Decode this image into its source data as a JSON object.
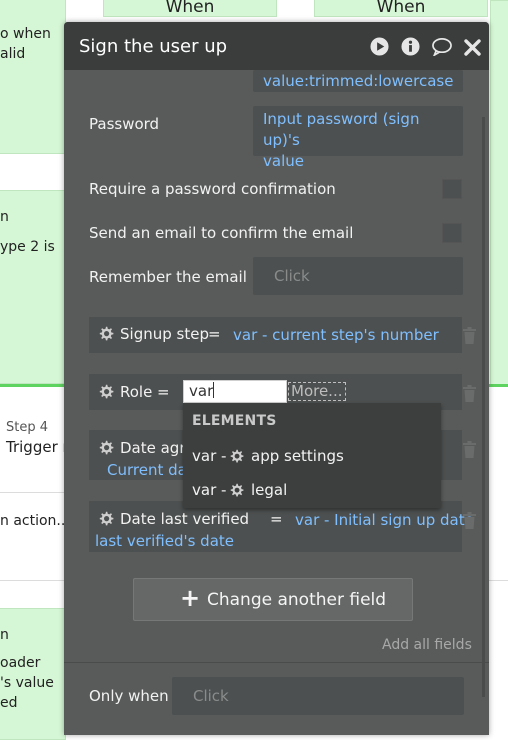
{
  "background": {
    "left_top_text": [
      "o when",
      "alid"
    ],
    "when_1": "When",
    "when_2": "When",
    "left_mid_text": [
      "n",
      "ype 2 is"
    ],
    "step_label": "Step 4",
    "step_title": "Trigger r",
    "action_text": "n action...",
    "left_bottom_text": [
      "n",
      "oader",
      "'s value",
      "ed"
    ]
  },
  "modal": {
    "title": "Sign the user up",
    "header_icons": [
      "play-icon",
      "info-icon",
      "comment-icon",
      "close-icon"
    ],
    "email_value_tail": "value:trimmed:lowercase",
    "password": {
      "label": "Password",
      "value_line1": "Input password (sign up)'s",
      "value_line2": "value"
    },
    "require_confirmation_label": "Require a password confirmation",
    "send_email_label": "Send an email to confirm the email",
    "remember_email": {
      "label": "Remember the email",
      "placeholder": "Click"
    },
    "fields": [
      {
        "key": "Signup step",
        "eq": "=",
        "value": "var - current step's number"
      },
      {
        "key": "Role",
        "eq": "=",
        "input_value": "var",
        "more": "More..."
      },
      {
        "key": "Date agre",
        "value": "Current dat"
      },
      {
        "key": "Date last verified",
        "eq": "=",
        "value_line1": "var - Initial sign up date",
        "value_line2": "last verified's date"
      }
    ],
    "dropdown": {
      "header": "ELEMENTS",
      "items": [
        {
          "prefix": "var -",
          "label": "app settings"
        },
        {
          "prefix": "var -",
          "label": "legal"
        }
      ]
    },
    "change_button": {
      "plus": "+",
      "label": "Change another field"
    },
    "add_all_fields": "Add all fields",
    "only_when": {
      "label": "Only when",
      "placeholder": "Click"
    }
  },
  "colors": {
    "header_bg": "#3b3d3d",
    "panel_bg": "#595b5b",
    "field_bg": "#4d5050",
    "link_blue": "#7fbfff",
    "canvas_green": "#d6f7d6"
  }
}
